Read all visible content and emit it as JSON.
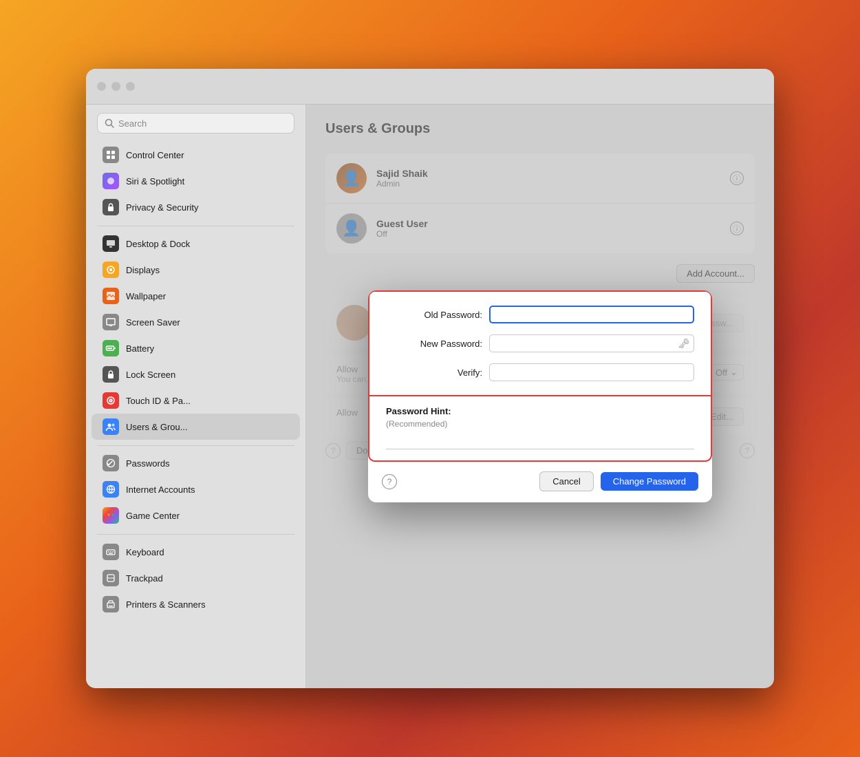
{
  "window": {
    "title": "Users & Groups"
  },
  "sidebar": {
    "search_placeholder": "Search",
    "items": [
      {
        "id": "control-center",
        "label": "Control Center",
        "icon": "⊞",
        "icon_class": "icon-control-center"
      },
      {
        "id": "siri-spotlight",
        "label": "Siri & Spotlight",
        "icon": "◉",
        "icon_class": "icon-siri"
      },
      {
        "id": "privacy-security",
        "label": "Privacy & Security",
        "icon": "🔒",
        "icon_class": "icon-privacy"
      },
      {
        "id": "desktop",
        "label": "Desktop & Dock",
        "icon": "▣",
        "icon_class": "icon-desktop"
      },
      {
        "id": "displays",
        "label": "Displays",
        "icon": "☀",
        "icon_class": "icon-displays"
      },
      {
        "id": "wallpaper",
        "label": "Wallpaper",
        "icon": "🖼",
        "icon_class": "icon-wallpaper"
      },
      {
        "id": "screen-saver",
        "label": "Screen Saver",
        "icon": "⬛",
        "icon_class": "icon-screensaver"
      },
      {
        "id": "battery",
        "label": "Battery",
        "icon": "🔋",
        "icon_class": "icon-battery"
      },
      {
        "id": "lock-screen",
        "label": "Lock Screen",
        "icon": "🔐",
        "icon_class": "icon-lockscreen"
      },
      {
        "id": "touch-id",
        "label": "Touch ID & Passcode",
        "icon": "◈",
        "icon_class": "icon-touchid"
      },
      {
        "id": "users-groups",
        "label": "Users & Groups",
        "icon": "👥",
        "icon_class": "icon-users"
      },
      {
        "id": "passwords",
        "label": "Passwords",
        "icon": "🔑",
        "icon_class": "icon-passwords"
      },
      {
        "id": "internet-accounts",
        "label": "Internet Accounts",
        "icon": "@",
        "icon_class": "icon-internet"
      },
      {
        "id": "game-center",
        "label": "Game Center",
        "icon": "●",
        "icon_class": "icon-gamecenter"
      },
      {
        "id": "keyboard",
        "label": "Keyboard",
        "icon": "⌨",
        "icon_class": "icon-keyboard"
      },
      {
        "id": "trackpad",
        "label": "Trackpad",
        "icon": "▭",
        "icon_class": "icon-trackpad"
      },
      {
        "id": "printers",
        "label": "Printers & Scanners",
        "icon": "🖨",
        "icon_class": "icon-printers"
      }
    ]
  },
  "main": {
    "title": "Users & Groups",
    "add_account_label": "Add Account...",
    "users": [
      {
        "id": "sajid",
        "name": "Sajid Shaik",
        "role": "Admin",
        "avatar_type": "photo"
      },
      {
        "id": "guest",
        "name": "Guest User",
        "role": "Off",
        "avatar_type": "generic"
      }
    ],
    "allow_section1": {
      "label": "Allow",
      "sub": "You can..."
    },
    "off_label": "Off",
    "edit_label": "Edit...",
    "done_label": "Done"
  },
  "modal": {
    "old_password_label": "Old Password:",
    "new_password_label": "New Password:",
    "verify_label": "Verify:",
    "password_hint_label": "Password Hint:",
    "recommended_label": "(Recommended)",
    "cancel_label": "Cancel",
    "change_password_label": "Change Password",
    "old_password_value": "",
    "new_password_value": "",
    "verify_value": "",
    "hint_value": ""
  }
}
